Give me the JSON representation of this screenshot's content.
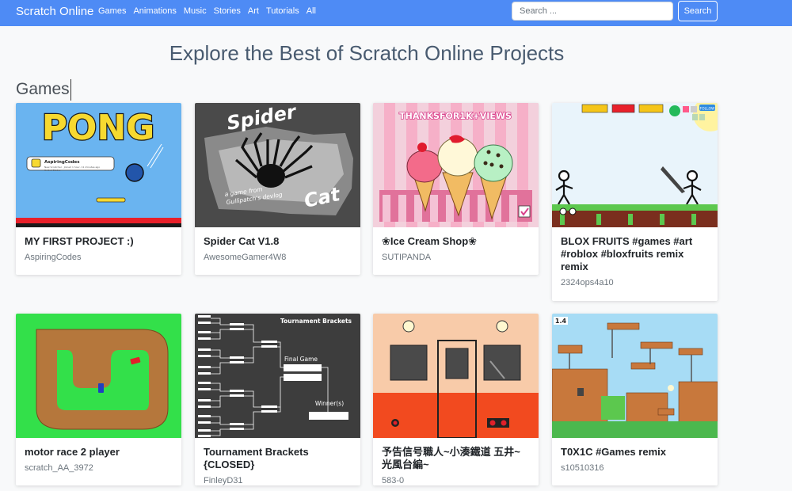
{
  "nav": {
    "brand": "Scratch Online",
    "links": [
      "Games",
      "Animations",
      "Music",
      "Stories",
      "Art",
      "Tutorials",
      "All"
    ],
    "search_placeholder": "Search ...",
    "search_button": "Search"
  },
  "page": {
    "heading": "Explore the Best of Scratch Online Projects",
    "section": "Games"
  },
  "cards": [
    {
      "title": "MY FIRST PROJECT :)",
      "author": "AspiringCodes",
      "thumb_text": "PONG",
      "thumb_sub": "AspiringCodes",
      "thumb_sub2": "New Scratcher - Joined 1 hour, 11 minutes ago United States"
    },
    {
      "title": "Spider Cat V1.8",
      "author": "AwesomeGamer4W8",
      "thumb_text": "Spider",
      "thumb_sub": "Cat",
      "thumb_sub2": "a game from Gullipatch's devlog"
    },
    {
      "title": "❀Ice Cream Shop❀",
      "author": "SUTIPANDA",
      "thumb_text": "THANKSFOR1K+VIEWS"
    },
    {
      "title": "BLOX FRUITS #games #art #roblox #bloxfruits remix remix",
      "author": "2324ops4a10",
      "thumb_text": "FOLLOW"
    },
    {
      "title": "motor race 2 player",
      "author": "scratch_AA_3972"
    },
    {
      "title": "Tournament Brackets {CLOSED}",
      "author": "FinleyD31",
      "thumb_text": "Tournament Brackets",
      "thumb_sub": "Final Game",
      "thumb_sub2": "Winner(s)"
    },
    {
      "title": "予告信号職人~小湊鐵道 五井~光風台編~",
      "author": "583-0"
    },
    {
      "title": "T0X1C #Games remix",
      "author": "s10510316",
      "thumb_text": "1.4"
    }
  ],
  "colors": {
    "navbar": "#4e8bf5",
    "pong_bg": "#6ab4f0",
    "pong_title": "#f7d930",
    "spider_bg": "#4a4a4a",
    "icecream_bg": "#f6b0c8",
    "blox_ground": "#5cc84e",
    "race_grass": "#33e04a",
    "race_track": "#b5773c",
    "bracket_bg": "#3d3d3d",
    "train_sky": "#f8cba9",
    "train_body": "#f24a1f",
    "toxic_sky": "#a7dcf5"
  }
}
